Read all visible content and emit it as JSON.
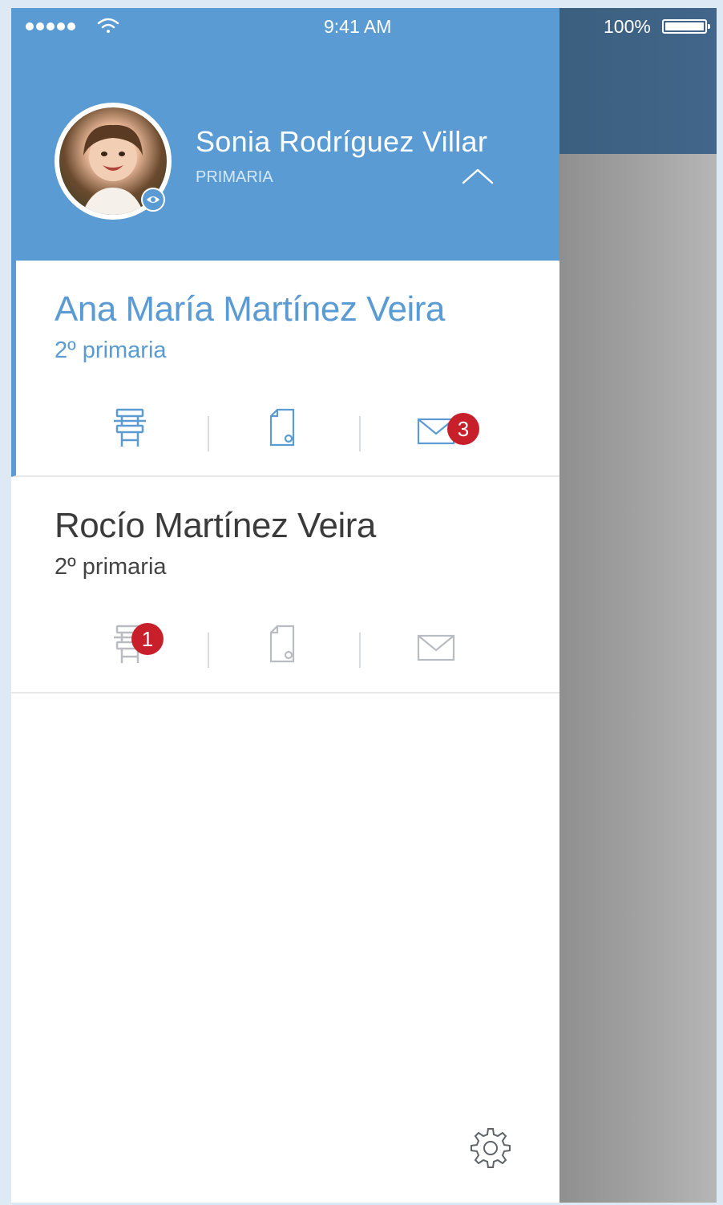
{
  "status_bar": {
    "time": "9:41 AM",
    "battery": "100%"
  },
  "profile": {
    "name": "Sonia Rodríguez Villar",
    "level": "PRIMARIA"
  },
  "children": [
    {
      "name": "Ana María Martínez Veira",
      "grade": "2º primaria",
      "active": true,
      "badges": {
        "messages": "3"
      }
    },
    {
      "name": "Rocío Martínez Veira",
      "grade": "2º primaria",
      "active": false,
      "badges": {
        "attendance": "1"
      }
    }
  ],
  "icons": {
    "avatar_overlay": "eye-icon",
    "toggle": "chevron-up-icon",
    "actions": [
      "school-chair-icon",
      "document-icon",
      "mail-icon"
    ],
    "footer": "gear-icon"
  },
  "colors": {
    "accent": "#5a9bd3",
    "badge": "#c8202a",
    "overlay": "#3b5f7e"
  }
}
